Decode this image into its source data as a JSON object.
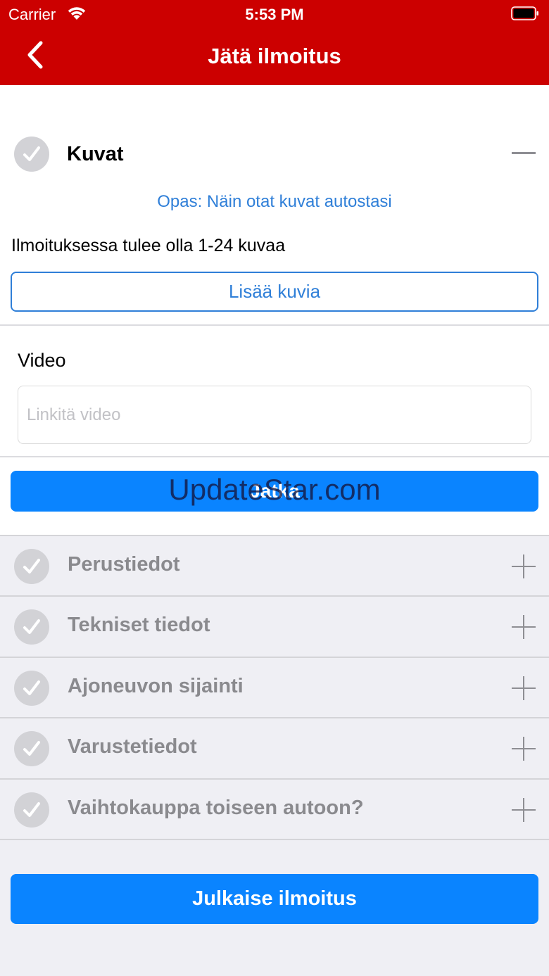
{
  "status": {
    "carrier": "Carrier",
    "time": "5:53 PM"
  },
  "nav": {
    "title": "Jätä ilmoitus"
  },
  "photos": {
    "title": "Kuvat",
    "guide_link": "Opas: Näin otat kuvat autostasi",
    "hint": "Ilmoituksessa tulee olla 1-24 kuvaa",
    "add_button": "Lisää kuvia"
  },
  "video": {
    "label": "Video",
    "placeholder": "Linkitä video",
    "value": ""
  },
  "continue_button": "Jatka",
  "watermark": "UpdateStar.com",
  "sections": [
    {
      "label": "Perustiedot"
    },
    {
      "label": "Tekniset tiedot"
    },
    {
      "label": "Ajoneuvon sijainti"
    },
    {
      "label": "Varustetiedot"
    },
    {
      "label": "Vaihtokauppa toiseen autoon?"
    }
  ],
  "publish_button": "Julkaise ilmoitus",
  "colors": {
    "header": "#cc0000",
    "accent": "#0a84ff",
    "link": "#2f7fd8",
    "background": "#efeff4"
  },
  "icons": {
    "back": "chevron-left-icon",
    "section_status": "checkmark-circle-icon",
    "collapse": "minus-icon",
    "expand": "plus-icon"
  }
}
